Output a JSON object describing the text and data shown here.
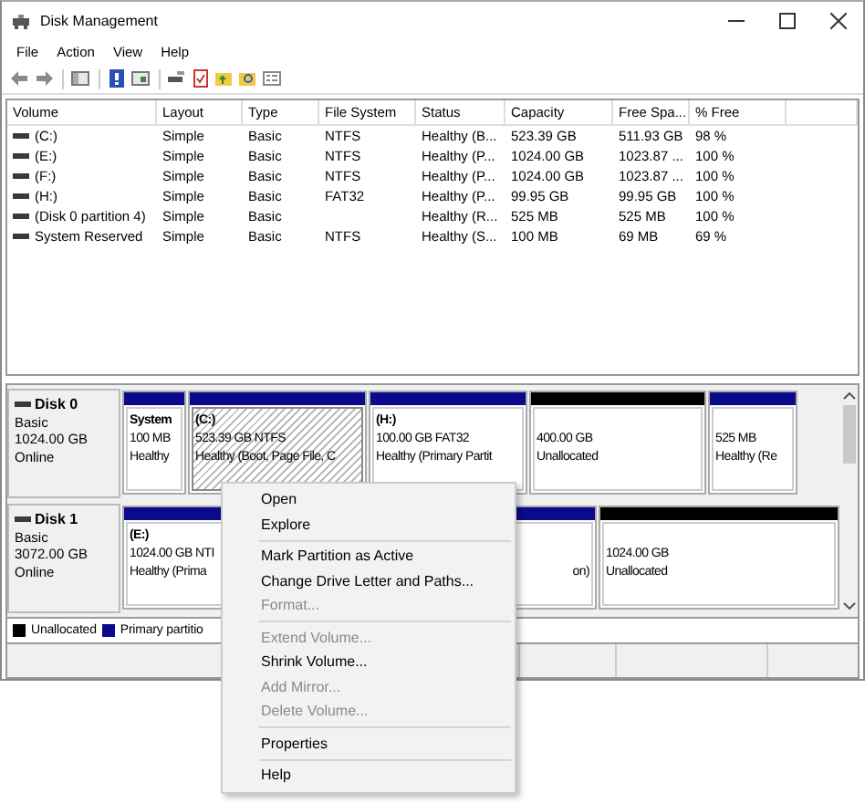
{
  "window": {
    "title": "Disk Management"
  },
  "menu_bar": [
    "File",
    "Action",
    "View",
    "Help"
  ],
  "volume_table": {
    "columns": [
      "Volume",
      "Layout",
      "Type",
      "File System",
      "Status",
      "Capacity",
      "Free Spa...",
      "% Free"
    ],
    "rows": [
      [
        "(C:)",
        "Simple",
        "Basic",
        "NTFS",
        "Healthy (B...",
        "523.39 GB",
        "511.93 GB",
        "98 %"
      ],
      [
        "(E:)",
        "Simple",
        "Basic",
        "NTFS",
        "Healthy (P...",
        "1024.00 GB",
        "1023.87 ...",
        "100 %"
      ],
      [
        "(F:)",
        "Simple",
        "Basic",
        "NTFS",
        "Healthy (P...",
        "1024.00 GB",
        "1023.87 ...",
        "100 %"
      ],
      [
        "(H:)",
        "Simple",
        "Basic",
        "FAT32",
        "Healthy (P...",
        "99.95 GB",
        "99.95 GB",
        "100 %"
      ],
      [
        "(Disk 0 partition 4)",
        "Simple",
        "Basic",
        "",
        "Healthy (R...",
        "525 MB",
        "525 MB",
        "100 %"
      ],
      [
        "System Reserved",
        "Simple",
        "Basic",
        "NTFS",
        "Healthy (S...",
        "100 MB",
        "69 MB",
        "69 %"
      ]
    ]
  },
  "disks": [
    {
      "name": "Disk 0",
      "type": "Basic",
      "size": "1024.00 GB",
      "status": "Online",
      "partitions": [
        {
          "kind": "primary",
          "selected": false,
          "name": "System",
          "size": "100 MB",
          "status": "Healthy"
        },
        {
          "kind": "primary",
          "selected": true,
          "name": "(C:)",
          "size": "523.39 GB NTFS",
          "status": "Healthy (Boot, Page File, C"
        },
        {
          "kind": "primary",
          "selected": false,
          "name": "(H:)",
          "size": "100.00 GB FAT32",
          "status": "Healthy (Primary Partit"
        },
        {
          "kind": "unallocated",
          "selected": false,
          "size": "400.00 GB",
          "status": "Unallocated"
        },
        {
          "kind": "primary",
          "selected": false,
          "size": "525 MB",
          "status": "Healthy (Re"
        }
      ]
    },
    {
      "name": "Disk 1",
      "type": "Basic",
      "size": "3072.00 GB",
      "status": "Online",
      "partitions": [
        {
          "kind": "primary",
          "selected": false,
          "name": "(E:)",
          "size": "1024.00 GB NTI",
          "status": "Healthy (Prima"
        },
        {
          "kind": "primary",
          "selected": false,
          "status": "on)"
        },
        {
          "kind": "unallocated",
          "selected": false,
          "size": "1024.00 GB",
          "status": "Unallocated"
        }
      ]
    }
  ],
  "legend": [
    {
      "label": "Unallocated",
      "color": "#000000"
    },
    {
      "label": "Primary partitio",
      "color": "#0a0a8c"
    }
  ],
  "context_menu": [
    {
      "kind": "item",
      "label": "Open",
      "disabled": false
    },
    {
      "kind": "item",
      "label": "Explore",
      "disabled": false
    },
    {
      "kind": "separator"
    },
    {
      "kind": "item",
      "label": "Mark Partition as Active",
      "disabled": false
    },
    {
      "kind": "item",
      "label": "Change Drive Letter and Paths...",
      "disabled": false
    },
    {
      "kind": "item",
      "label": "Format...",
      "disabled": true
    },
    {
      "kind": "separator"
    },
    {
      "kind": "item",
      "label": "Extend Volume...",
      "disabled": true
    },
    {
      "kind": "item",
      "label": "Shrink Volume...",
      "disabled": false
    },
    {
      "kind": "item",
      "label": "Add Mirror...",
      "disabled": true
    },
    {
      "kind": "item",
      "label": "Delete Volume...",
      "disabled": true
    },
    {
      "kind": "separator"
    },
    {
      "kind": "item",
      "label": "Properties",
      "disabled": false
    },
    {
      "kind": "separator"
    },
    {
      "kind": "item",
      "label": "Help",
      "disabled": false
    }
  ]
}
